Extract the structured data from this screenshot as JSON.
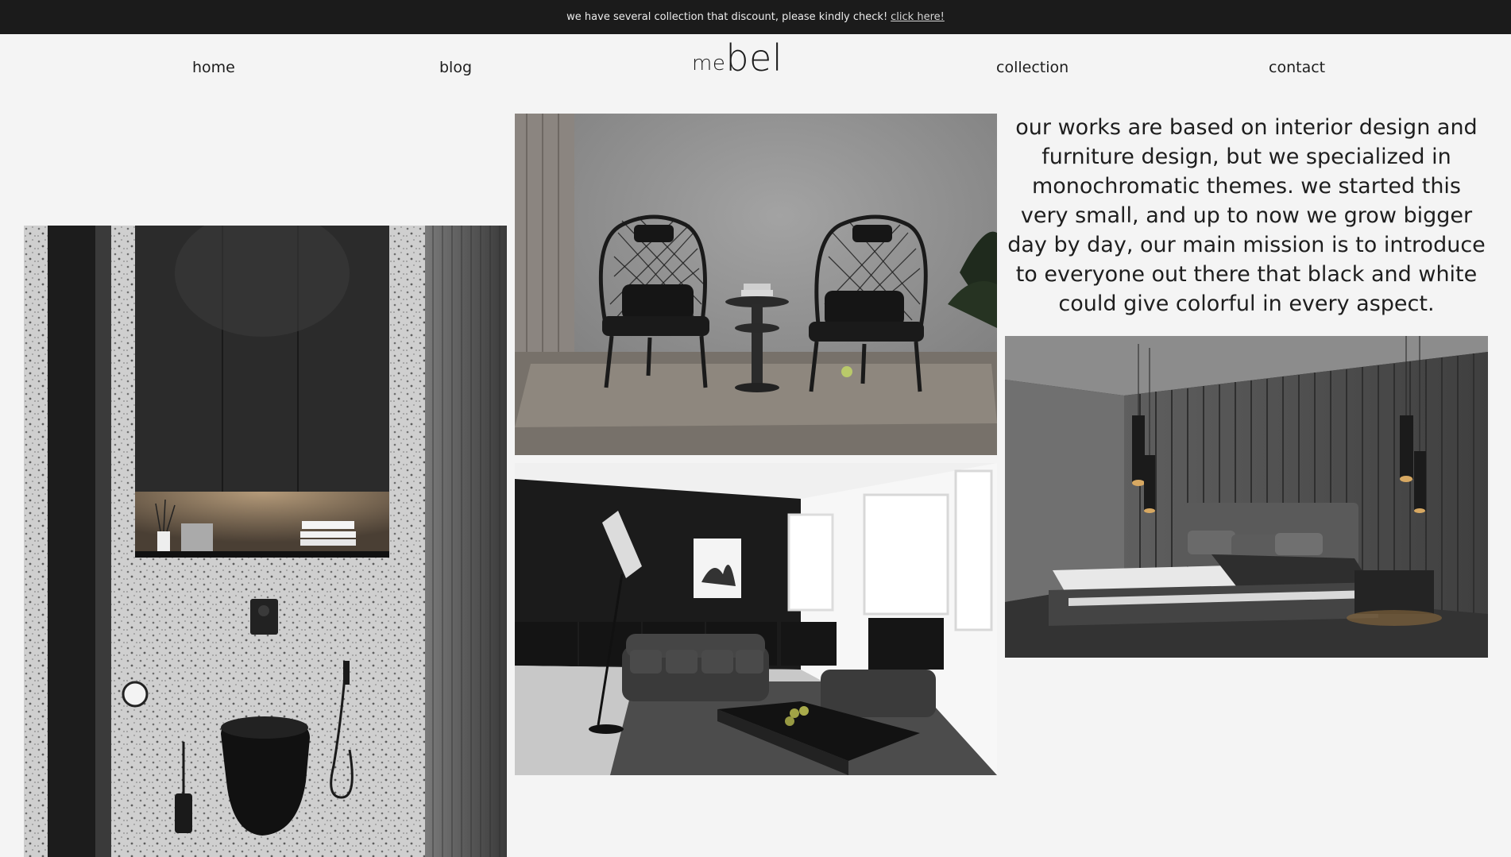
{
  "announcement": {
    "text": "we have several collection that discount, please kindly check!",
    "link_label": "click here!"
  },
  "nav": {
    "home": "home",
    "blog": "blog",
    "collection": "collection",
    "contact": "contact"
  },
  "logo": {
    "small": "me",
    "big": "bel"
  },
  "about": {
    "text": "our works are based on interior design and furniture design, but we specialized in monochromatic themes. we started this very small, and up to now we grow bigger day by day, our main mission is to introduce to everyone out there that black and white could give colorful in every aspect."
  },
  "colors": {
    "announcement_bg": "#1b1b1b",
    "page_bg": "#f4f4f4",
    "text": "#1b1b1b"
  }
}
